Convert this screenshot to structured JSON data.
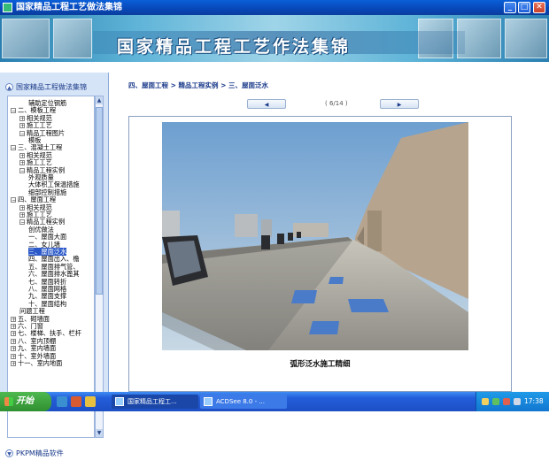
{
  "window": {
    "title": "国家精品工程工艺做法集锦"
  },
  "banner": {
    "title": "国家精品工程工艺作法集锦"
  },
  "sidebar": {
    "header": "国家精品工程做法集锦",
    "header_icon": "chevron-up-icon",
    "footer": "PKPM精品软件",
    "footer_icon": "chevron-down-icon",
    "tree": [
      {
        "text": "辅助定位钢筋",
        "indent": 2,
        "toggle": ""
      },
      {
        "text": "二、模板工程",
        "indent": 0,
        "toggle": "−"
      },
      {
        "text": "相关规范",
        "indent": 1,
        "toggle": "+"
      },
      {
        "text": "施工工艺",
        "indent": 1,
        "toggle": "+"
      },
      {
        "text": "精品工程图片",
        "indent": 1,
        "toggle": "−"
      },
      {
        "text": "模板",
        "indent": 2,
        "toggle": ""
      },
      {
        "text": "三、混凝土工程",
        "indent": 0,
        "toggle": "−"
      },
      {
        "text": "相关规范",
        "indent": 1,
        "toggle": "+"
      },
      {
        "text": "施工工艺",
        "indent": 1,
        "toggle": "+"
      },
      {
        "text": "精品工程实例",
        "indent": 1,
        "toggle": "−"
      },
      {
        "text": "外观质量",
        "indent": 2,
        "toggle": ""
      },
      {
        "text": "大体积工保温措施",
        "indent": 2,
        "toggle": ""
      },
      {
        "text": "细部控制措施",
        "indent": 2,
        "toggle": ""
      },
      {
        "text": "四、屋面工程",
        "indent": 0,
        "toggle": "−"
      },
      {
        "text": "相关规范",
        "indent": 1,
        "toggle": "+"
      },
      {
        "text": "施工工艺",
        "indent": 1,
        "toggle": "+"
      },
      {
        "text": "精品工程实例",
        "indent": 1,
        "toggle": "−"
      },
      {
        "text": "创优做法",
        "indent": 2,
        "toggle": ""
      },
      {
        "text": "一、屋面大面",
        "indent": 2,
        "toggle": ""
      },
      {
        "text": "二、女儿墙",
        "indent": 2,
        "toggle": ""
      },
      {
        "text": "三、屋面泛水",
        "indent": 2,
        "toggle": "",
        "selected": true
      },
      {
        "text": "四、屋面出入、檐",
        "indent": 2,
        "toggle": ""
      },
      {
        "text": "五、屋面排气管、",
        "indent": 2,
        "toggle": ""
      },
      {
        "text": "六、屋面排水篦其",
        "indent": 2,
        "toggle": ""
      },
      {
        "text": "七、屋面转折",
        "indent": 2,
        "toggle": ""
      },
      {
        "text": "八、屋面网格",
        "indent": 2,
        "toggle": ""
      },
      {
        "text": "九、屋面支撑",
        "indent": 2,
        "toggle": ""
      },
      {
        "text": "十、屋面结构",
        "indent": 2,
        "toggle": ""
      },
      {
        "text": "问题工程",
        "indent": 1,
        "toggle": ""
      },
      {
        "text": "五、砌墙面",
        "indent": 0,
        "toggle": "+"
      },
      {
        "text": "六、门窗",
        "indent": 0,
        "toggle": "+"
      },
      {
        "text": "七、楼梯、扶手、栏杆",
        "indent": 0,
        "toggle": "+"
      },
      {
        "text": "八、室内顶棚",
        "indent": 0,
        "toggle": "+"
      },
      {
        "text": "九、室内墙面",
        "indent": 0,
        "toggle": "+"
      },
      {
        "text": "十、室外墙面",
        "indent": 0,
        "toggle": "+"
      },
      {
        "text": "十一、室内地面",
        "indent": 0,
        "toggle": "+"
      }
    ]
  },
  "main": {
    "breadcrumb": "四、屋面工程 > 精品工程实例 > 三、屋面泛水",
    "pager": "( 6/14 )",
    "prev_icon": "arrow-left-icon",
    "next_icon": "arrow-right-icon",
    "caption": "弧形泛水施工精细"
  },
  "taskbar": {
    "start": "开始",
    "tasks": [
      {
        "label": "国家精品工程工..."
      },
      {
        "label": "ACDSee 8.0 - ..."
      }
    ],
    "clock": "17:38"
  },
  "colors": {
    "titlebar": "#0847b8",
    "taskbar": "#245edb",
    "sidebar": "#d6e4f7",
    "selection": "#2a58c8",
    "start": "#2f8f2f"
  }
}
